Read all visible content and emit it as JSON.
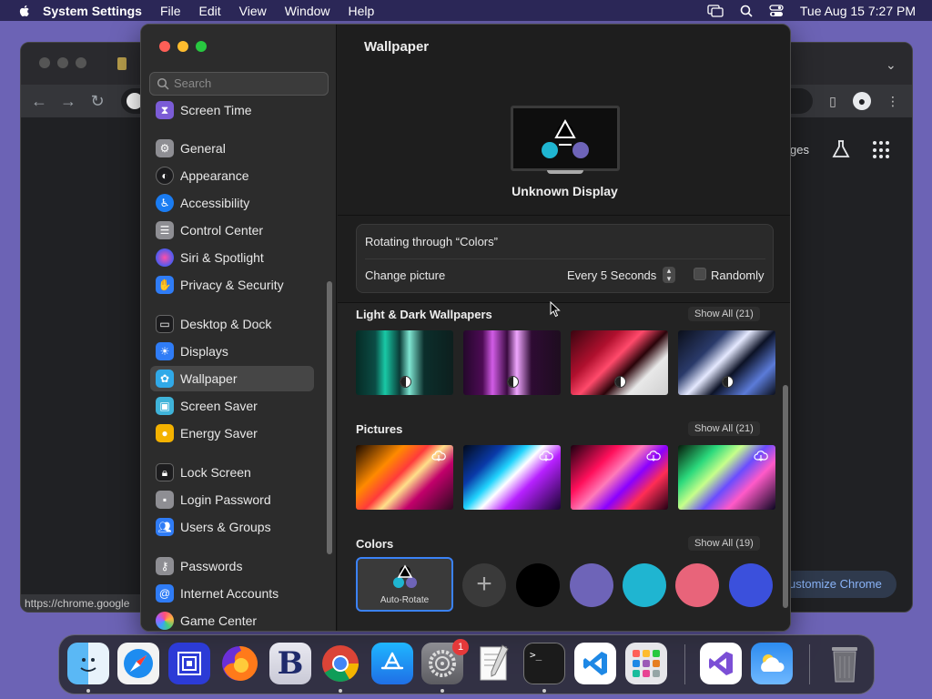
{
  "menubar": {
    "app_name": "System Settings",
    "items": [
      "File",
      "Edit",
      "View",
      "Window",
      "Help"
    ],
    "clock": "Tue Aug 15  7:27 PM"
  },
  "chrome": {
    "partial_text": "ges",
    "customize_label": "ustomize Chrome",
    "status_url": "https://chrome.google"
  },
  "settings": {
    "search_placeholder": "Search",
    "sidebar": [
      {
        "label": "Screen Time",
        "color": "#7b5cd6"
      },
      {
        "label": "General",
        "color": "#8e8e93"
      },
      {
        "label": "Appearance",
        "color": "#1c1c1e"
      },
      {
        "label": "Accessibility",
        "color": "#1a7cf2"
      },
      {
        "label": "Control Center",
        "color": "#8e8e93"
      },
      {
        "label": "Siri & Spotlight",
        "color": "#c33bd6"
      },
      {
        "label": "Privacy & Security",
        "color": "#2f7cf6"
      },
      {
        "label": "Desktop & Dock",
        "color": "#1c1c1e"
      },
      {
        "label": "Displays",
        "color": "#2f7cf6"
      },
      {
        "label": "Wallpaper",
        "color": "#30a9e8"
      },
      {
        "label": "Screen Saver",
        "color": "#3fb3d9"
      },
      {
        "label": "Energy Saver",
        "color": "#f4b200"
      },
      {
        "label": "Lock Screen",
        "color": "#1c1c1e"
      },
      {
        "label": "Login Password",
        "color": "#8e8e93"
      },
      {
        "label": "Users & Groups",
        "color": "#2f7cf6"
      },
      {
        "label": "Passwords",
        "color": "#8e8e93"
      },
      {
        "label": "Internet Accounts",
        "color": "#2f7cf6"
      },
      {
        "label": "Game Center",
        "color": "#f2f2f2"
      }
    ],
    "selected": "Wallpaper",
    "main": {
      "title": "Wallpaper",
      "display_name": "Unknown Display",
      "rotating_text": "Rotating through “Colors”",
      "change_picture_label": "Change picture",
      "frequency": "Every 5 Seconds",
      "randomly_label": "Randomly",
      "randomly_checked": false,
      "sections": [
        {
          "title": "Light & Dark Wallpapers",
          "show_all": "Show All (21)"
        },
        {
          "title": "Pictures",
          "show_all": "Show All (21)"
        },
        {
          "title": "Colors",
          "show_all": "Show All (19)"
        }
      ],
      "auto_rotate_label": "Auto-Rotate",
      "color_swatches": [
        "#000000",
        "#6e64b8",
        "#1fb5d1",
        "#e8647a",
        "#3b50dc"
      ]
    }
  },
  "dock": {
    "apps": [
      "Finder",
      "Safari",
      "Screen Sharing",
      "Firefox",
      "BBEdit",
      "Chrome",
      "App Store",
      "System Settings",
      "TextEdit",
      "Terminal",
      "Visual Studio Code",
      "Launchpad",
      "Visual Studio",
      "Weather",
      "Trash"
    ],
    "system_settings_badge": "1"
  }
}
